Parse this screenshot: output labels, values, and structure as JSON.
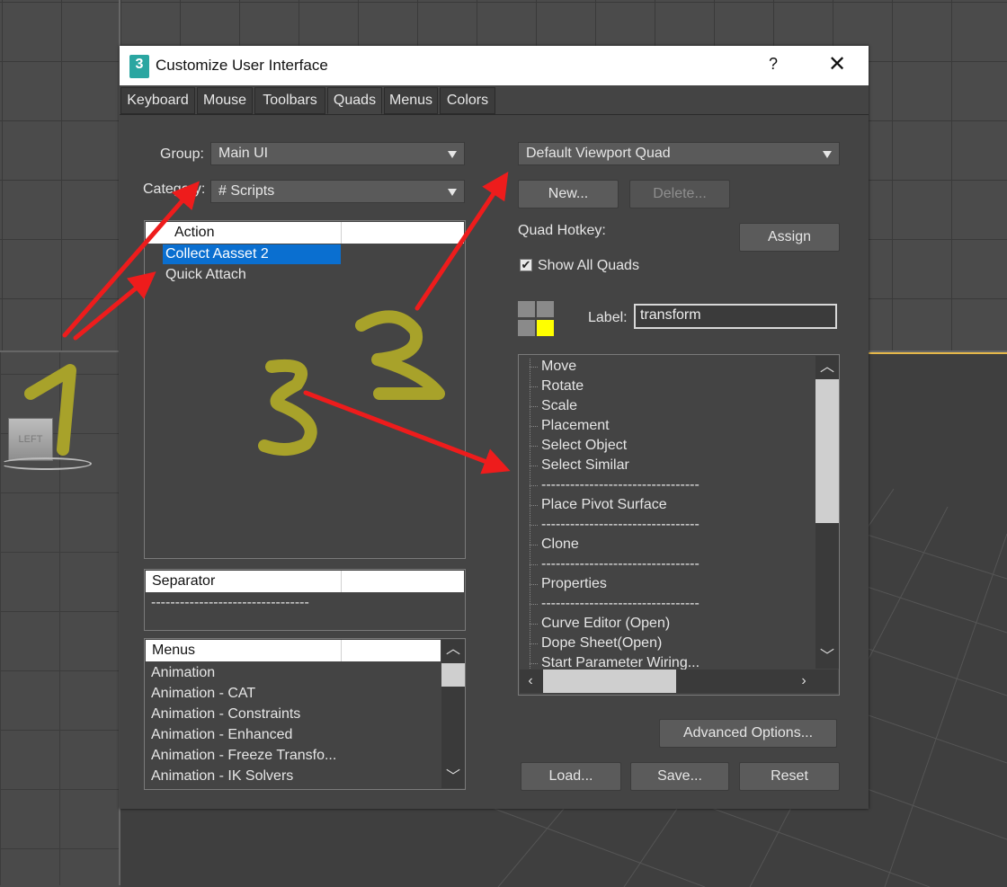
{
  "viewport": {
    "left_label": "LEFT"
  },
  "dialog": {
    "title": "Customize User Interface",
    "help": "?",
    "close": "✕",
    "tabs": [
      "Keyboard",
      "Mouse",
      "Toolbars",
      "Quads",
      "Menus",
      "Colors"
    ],
    "active_tab": "Quads"
  },
  "left": {
    "group_label": "Group:",
    "group_value": "Main UI",
    "category_label": "Category:",
    "category_value": "# Scripts",
    "action_header": "Action",
    "actions": [
      "Collect Aasset 2",
      "Quick Attach"
    ],
    "selected_action": "Collect Aasset 2",
    "separator_header": "Separator",
    "separator_item": "---------------------------------",
    "menus_header": "Menus",
    "menus": [
      "Animation",
      "Animation - CAT",
      "Animation - Constraints",
      "Animation - Enhanced",
      "Animation - Freeze Transfo...",
      "Animation - IK Solvers"
    ]
  },
  "right": {
    "quad_dropdown": "Default Viewport Quad",
    "new_button": "New...",
    "delete_button": "Delete...",
    "hotkey_label": "Quad Hotkey:",
    "assign_button": "Assign",
    "show_all_label": "Show All Quads",
    "show_all_checked": true,
    "checkmark": "✔",
    "label_label": "Label:",
    "label_value": "transform",
    "quad_colors": {
      "active": "#ffff00",
      "inactive": "#8a8a8a"
    },
    "quad_items": [
      "Move",
      "Rotate",
      "Scale",
      "Placement",
      "Select Object",
      "Select Similar",
      "---------------------------------",
      "Place Pivot Surface",
      "---------------------------------",
      "Clone",
      "---------------------------------",
      "Properties",
      "---------------------------------",
      "Curve Editor (Open)",
      "Dope Sheet(Open)",
      "Start Parameter Wiring..."
    ],
    "advanced_button": "Advanced Options...",
    "load_button": "Load...",
    "save_button": "Save...",
    "reset_button": "Reset"
  },
  "annotations": {
    "numbers": [
      "1",
      "2",
      "3"
    ],
    "marker_color": "#a8a22a",
    "arrow_color": "#ee1c1c"
  }
}
